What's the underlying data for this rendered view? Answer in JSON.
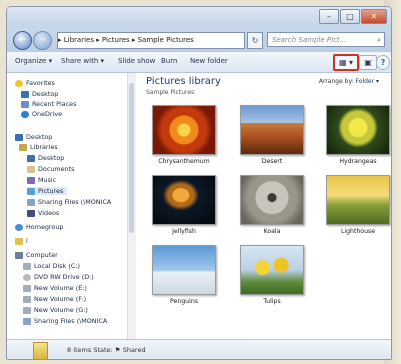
{
  "window": {
    "address": "▸ Libraries ▸ Pictures ▸ Sample Pictures",
    "search_placeholder": "Search Sample Pict...",
    "back_glyph": "←",
    "forward_glyph": "→",
    "refresh_glyph": "↻",
    "min_glyph": "–",
    "max_glyph": "□",
    "close_glyph": "✕"
  },
  "toolbar": {
    "organize": "Organize ▾",
    "share_with": "Share with ▾",
    "slide_show": "Slide show",
    "burn": "Burn",
    "new_folder": "New folder",
    "view_glyph": "▦ ▾",
    "preview_glyph": "▣",
    "help_glyph": "?"
  },
  "nav": {
    "favorites": "Favorites",
    "desktop": "Desktop",
    "recent_places": "Recent Places",
    "onedrive": "OneDrive",
    "desktop2": "Desktop",
    "libraries": "Libraries",
    "lib_desktop": "Desktop",
    "documents": "Documents",
    "music": "Music",
    "pictures": "Pictures",
    "sharing": "Sharing Files (\\MONICA",
    "videos": "Videos",
    "homegroup": "Homegroup",
    "user": "l",
    "computer": "Computer",
    "local_disk": "Local Disk (C:)",
    "dvd": "DVD RW Drive (D:)",
    "vol1": "New Volume (E:)",
    "vol2": "New Volume (F:)",
    "vol3": "New Volume (G:)",
    "sharing2": "Sharing Files (\\MONICA"
  },
  "content": {
    "title": "Pictures library",
    "subtitle": "Sample Pictures",
    "arrange_label": "Arrange by:",
    "arrange_value": "Folder ▾",
    "items": [
      "Chrysanthemum",
      "Desert",
      "Hydrangeas",
      "Jellyfish",
      "Koala",
      "Lighthouse",
      "Penguins",
      "Tulips"
    ]
  },
  "status": {
    "text": "8 items   State: ⚑ Shared"
  }
}
